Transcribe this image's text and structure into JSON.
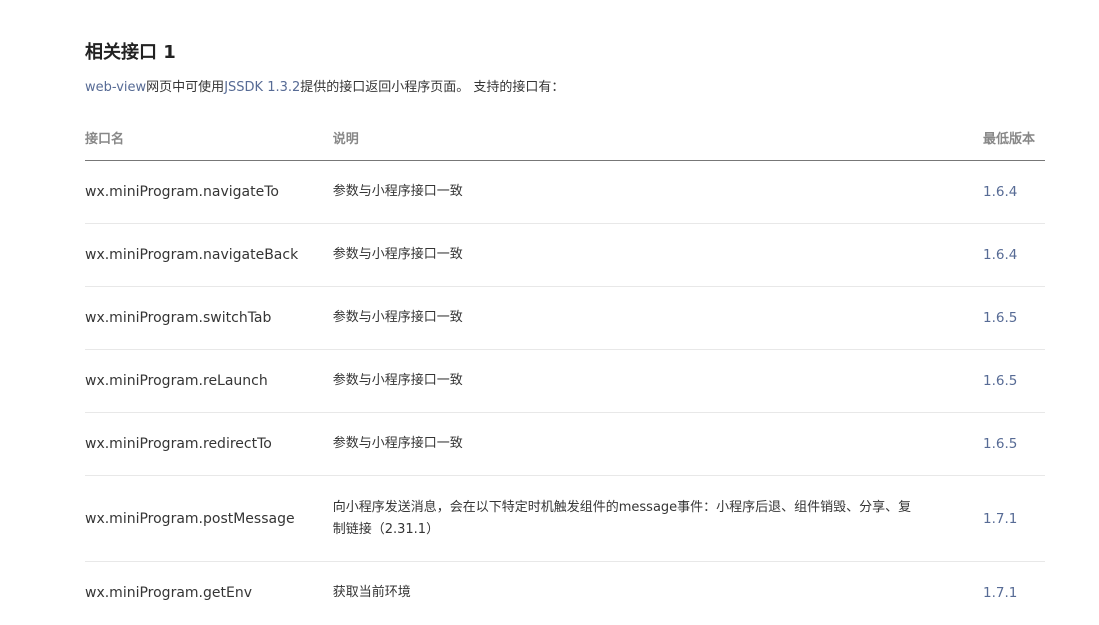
{
  "heading": "相关接口 1",
  "intro": {
    "link_text": "web-view",
    "text_before_sdk": "网页中可使用",
    "sdk": "JSSDK 1.3.2",
    "text_after_sdk": "提供的接口返回小程序页面。 支持的接口有："
  },
  "table": {
    "headers": {
      "name": "接口名",
      "desc": "说明",
      "version": "最低版本"
    },
    "rows": [
      {
        "name": "wx.miniProgram.navigateTo",
        "desc": "参数与小程序接口一致",
        "version": "1.6.4"
      },
      {
        "name": "wx.miniProgram.navigateBack",
        "desc": "参数与小程序接口一致",
        "version": "1.6.4"
      },
      {
        "name": "wx.miniProgram.switchTab",
        "desc": "参数与小程序接口一致",
        "version": "1.6.5"
      },
      {
        "name": "wx.miniProgram.reLaunch",
        "desc": "参数与小程序接口一致",
        "version": "1.6.5"
      },
      {
        "name": "wx.miniProgram.redirectTo",
        "desc": "参数与小程序接口一致",
        "version": "1.6.5"
      },
      {
        "name": "wx.miniProgram.postMessage",
        "desc": "向小程序发送消息，会在以下特定时机触发组件的message事件：小程序后退、组件销毁、分享、复制链接（2.31.1）",
        "version": "1.7.1"
      },
      {
        "name": "wx.miniProgram.getEnv",
        "desc": "获取当前环境",
        "version": "1.7.1"
      }
    ]
  },
  "colors": {
    "link": "#576b95",
    "text": "#353535",
    "header_text": "#888888"
  }
}
